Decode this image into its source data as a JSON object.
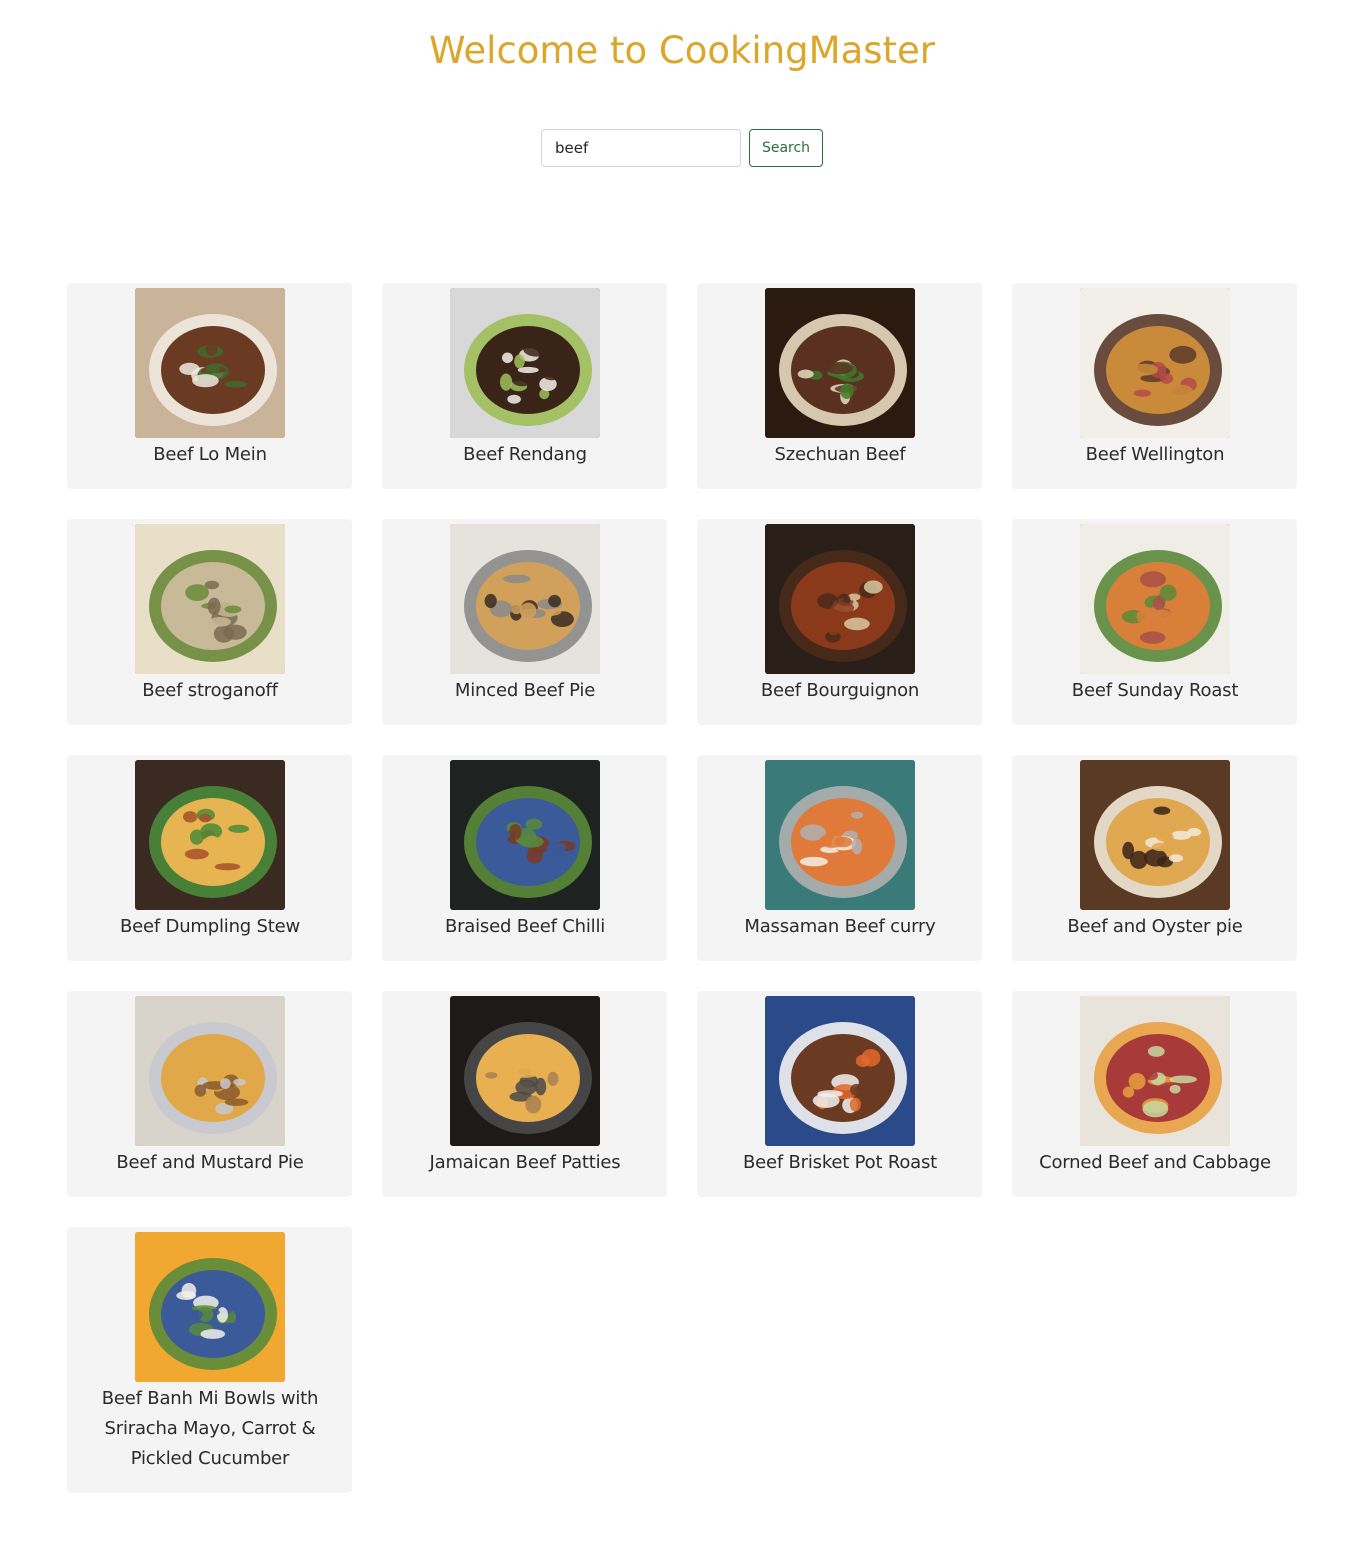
{
  "header": {
    "title": "Welcome to CookingMaster"
  },
  "search": {
    "value": "beef",
    "placeholder": "",
    "button_label": "Search"
  },
  "colors": {
    "title": "#dba62a",
    "search_button": "#28703a",
    "card_background": "#f4f4f4"
  },
  "recipes": [
    {
      "name": "Beef Lo Mein",
      "image": "beef-lo-mein-photo",
      "palette": [
        "#c9b49a",
        "#6b3a22",
        "#3f6b2a",
        "#efe9e0"
      ]
    },
    {
      "name": "Beef Rendang",
      "image": "beef-rendang-photo",
      "palette": [
        "#d8d8d8",
        "#3a2418",
        "#f4f1ea",
        "#9fbf5a"
      ]
    },
    {
      "name": "Szechuan Beef",
      "image": "szechuan-beef-photo",
      "palette": [
        "#2a1a10",
        "#5a3020",
        "#3f7a2a",
        "#e8dcc0"
      ]
    },
    {
      "name": "Beef Wellington",
      "image": "beef-wellington-photo",
      "palette": [
        "#f2eee8",
        "#c98a3a",
        "#b44a4a",
        "#5a3a2a"
      ]
    },
    {
      "name": "Beef stroganoff",
      "image": "beef-stroganoff-photo",
      "palette": [
        "#e9dfc8",
        "#c8b998",
        "#7a6a50",
        "#6a8a3a"
      ]
    },
    {
      "name": "Minced Beef Pie",
      "image": "minced-beef-pie-photo",
      "palette": [
        "#e6e3de",
        "#d1a05a",
        "#3a2a22",
        "#8a8a8a"
      ]
    },
    {
      "name": "Beef Bourguignon",
      "image": "beef-bourguignon-photo",
      "palette": [
        "#2a1e18",
        "#8a3a1a",
        "#d8c8a0",
        "#4a2a1a"
      ]
    },
    {
      "name": "Beef Sunday Roast",
      "image": "beef-sunday-roast-photo",
      "palette": [
        "#f0ece6",
        "#d8803a",
        "#a8504a",
        "#5a8a3a"
      ]
    },
    {
      "name": "Beef Dumpling Stew",
      "image": "beef-dumpling-stew-photo",
      "palette": [
        "#3a2a22",
        "#e6b450",
        "#a8502a",
        "#4a8a3a"
      ]
    },
    {
      "name": "Braised Beef Chilli",
      "image": "braised-beef-chilli-photo",
      "palette": [
        "#1e2220",
        "#3a5a9a",
        "#7a3a22",
        "#5a8a3a"
      ]
    },
    {
      "name": "Massaman Beef curry",
      "image": "massaman-beef-curry-photo",
      "palette": [
        "#3a7a78",
        "#e07a3a",
        "#f2eee6",
        "#b0b0b0"
      ]
    },
    {
      "name": "Beef and Oyster pie",
      "image": "beef-and-oyster-pie-photo",
      "palette": [
        "#5a3a22",
        "#e0a850",
        "#3a2218",
        "#f2ead8"
      ]
    },
    {
      "name": "Beef and Mustard Pie",
      "image": "beef-and-mustard-pie-photo",
      "palette": [
        "#d8d4cc",
        "#e0a848",
        "#8a5a2a",
        "#c8c8d0"
      ]
    },
    {
      "name": "Jamaican Beef Patties",
      "image": "jamaican-beef-patties-photo",
      "palette": [
        "#1e1a18",
        "#e8b050",
        "#a88050",
        "#4a4a4a"
      ]
    },
    {
      "name": "Beef Brisket Pot Roast",
      "image": "beef-brisket-pot-roast-photo",
      "palette": [
        "#2a4a8a",
        "#6a3a22",
        "#e06a2a",
        "#f2f2f2"
      ]
    },
    {
      "name": "Corned Beef and Cabbage",
      "image": "corned-beef-and-cabbage-photo",
      "palette": [
        "#e8e4dc",
        "#a83a3a",
        "#c8d8a0",
        "#e8a040"
      ]
    },
    {
      "name": "Beef Banh Mi Bowls with Sriracha Mayo, Carrot & Pickled Cucumber",
      "image": "beef-banh-mi-bowl-photo",
      "palette": [
        "#f0a830",
        "#3a5a9a",
        "#f2f0ea",
        "#5a8a3a"
      ]
    }
  ]
}
